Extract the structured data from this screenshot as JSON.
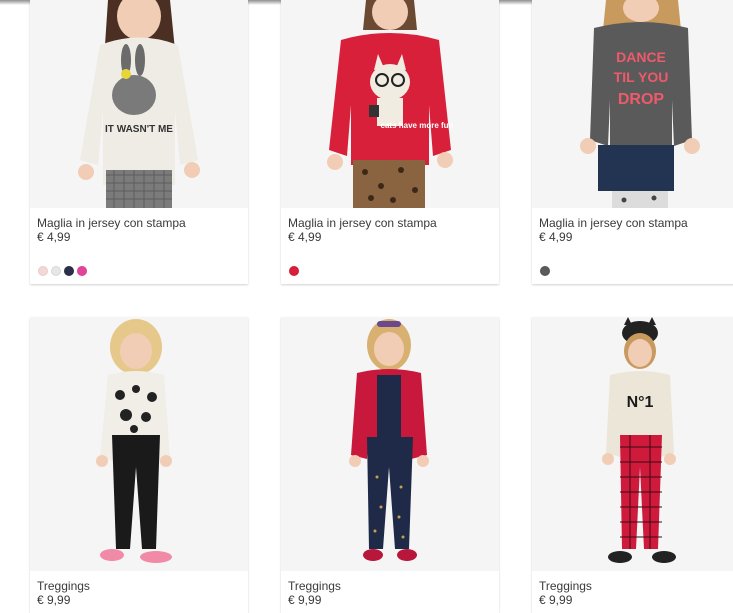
{
  "products": [
    {
      "name": "Maglia in jersey con stampa",
      "price": "€ 4,99",
      "print_text": "IT WASN'T ME",
      "swatches": [
        "#f3d9d6",
        "#e6e6e6",
        "#2c2f4a",
        "#e2449a"
      ]
    },
    {
      "name": "Maglia in jersey con stampa",
      "price": "€ 4,99",
      "print_text": "cats have more fun",
      "swatches": [
        "#d9203a"
      ]
    },
    {
      "name": "Maglia in jersey con stampa",
      "price": "€ 4,99",
      "print_text": "DANCE TIL YOU DROP",
      "swatches": [
        "#5a5a5a"
      ]
    },
    {
      "name": "Treggings",
      "price": "€ 9,99",
      "print_text": ""
    },
    {
      "name": "Treggings",
      "price": "€ 9,99",
      "print_text": ""
    },
    {
      "name": "Treggings",
      "price": "€ 9,99",
      "print_text": "N°1"
    }
  ],
  "colors": {
    "background": "#ffffff",
    "card_photo_bg": "#f5f5f5",
    "text": "#3a3a3a"
  },
  "icons": [
    "color-swatch-icon"
  ]
}
